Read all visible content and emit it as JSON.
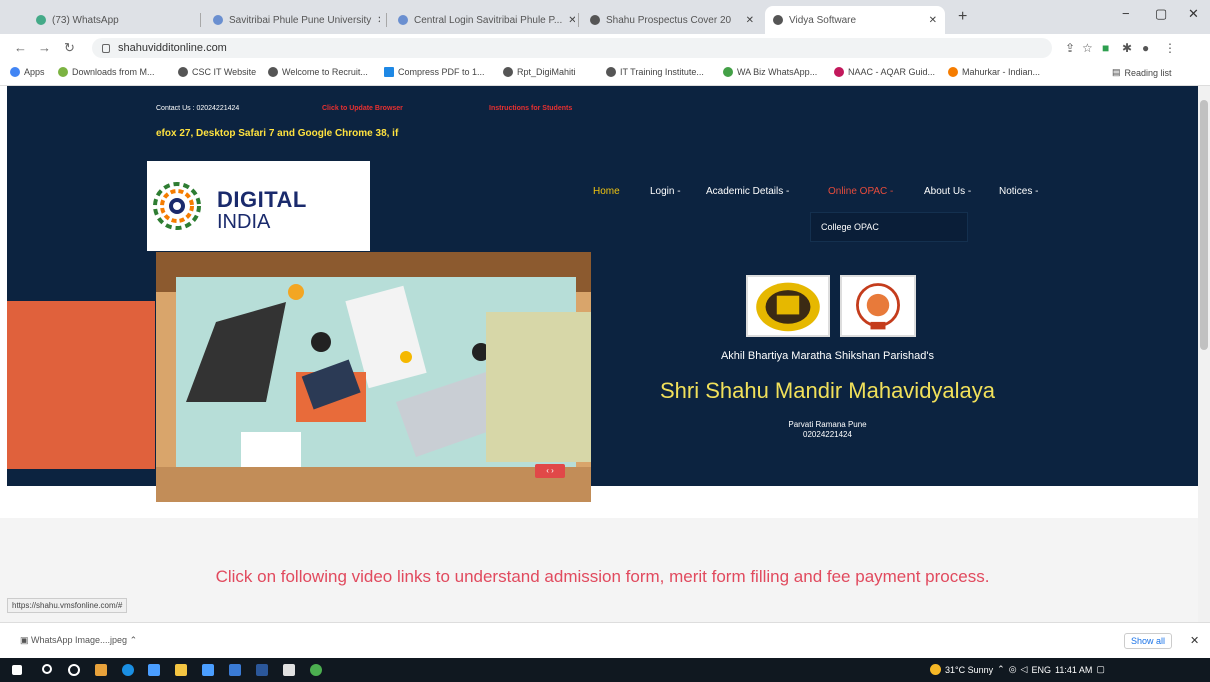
{
  "browser": {
    "tabs": [
      {
        "label": "(73) WhatsApp"
      },
      {
        "label": "Savitribai Phule Pune University"
      },
      {
        "label": "Central Login Savitribai Phule P..."
      },
      {
        "label": "Shahu Prospectus Cover 20"
      },
      {
        "label": "Vidya Software"
      }
    ],
    "new_tab": "+",
    "url": "shahuvidditonline.com",
    "window_controls": {
      "minimize": "−",
      "maximize": "▢",
      "close": "✕"
    },
    "bookmarks": [
      {
        "label": "Apps",
        "color": "#4285f4"
      },
      {
        "label": "Downloads from M...",
        "color": "#7cb342"
      },
      {
        "label": "CSC IT Website",
        "color": "#555555"
      },
      {
        "label": "Welcome to Recruit...",
        "color": "#555555"
      },
      {
        "label": "Compress PDF to 1...",
        "color": "#1e88e5"
      },
      {
        "label": "Rpt_DigiMahiti",
        "color": "#555555"
      },
      {
        "label": "IT Training Institute...",
        "color": "#555555"
      },
      {
        "label": "WA Biz WhatsApp...",
        "color": "#43a047"
      },
      {
        "label": "NAAC - AQAR Guid...",
        "color": "#c2185b"
      },
      {
        "label": "Mahurkar - Indian...",
        "color": "#f57c00"
      }
    ],
    "reading_list": "Reading list",
    "status_url": "https://shahu.vmsfonline.com/#"
  },
  "site": {
    "contact": "Contact Us : 02024221424",
    "red_link_1": "Click to Update Browser",
    "red_link_2": "Instructions for Students",
    "marquee": "efox 27, Desktop Safari 7 and Google Chrome 38, if",
    "logo": {
      "line1": "DIGITAL",
      "line2": "INDIA"
    },
    "nav": {
      "home": "Home",
      "login": "Login -",
      "academic": "Academic Details -",
      "opac": "Online OPAC -",
      "about": "About Us -",
      "notices": "Notices -"
    },
    "dropdown": {
      "college_opac": "College OPAC"
    },
    "slider_arrows": "‹ ›",
    "parishad": "Akhil Bhartiya Maratha Shikshan Parishad's",
    "college_name": "Shri Shahu Mandir Mahavidyalaya",
    "address": "Parvati Ramana Pune",
    "phone": "02024221424",
    "video_text": "Click on following video links to understand admission form, merit form filling and fee payment process."
  },
  "downloads": {
    "item": "WhatsApp Image....jpeg",
    "show_all": "Show all",
    "close": "✕"
  },
  "taskbar": {
    "weather": "31°C Sunny",
    "lang": "ENG",
    "time": "11:41 AM"
  },
  "colors": {
    "navy": "#0c2340",
    "yellow": "#f1e05a",
    "orange": "#e0613c",
    "pink_text": "#e14a5e"
  }
}
